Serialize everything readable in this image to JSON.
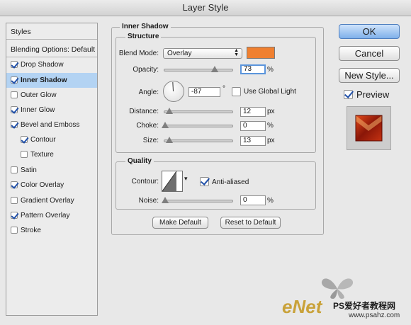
{
  "window": {
    "title": "Layer Style"
  },
  "sidebar": {
    "header": "Styles",
    "blending": "Blending Options: Default",
    "items": [
      {
        "label": "Drop Shadow",
        "checked": true
      },
      {
        "label": "Inner Shadow",
        "checked": true,
        "selected": true
      },
      {
        "label": "Outer Glow",
        "checked": false
      },
      {
        "label": "Inner Glow",
        "checked": true
      },
      {
        "label": "Bevel and Emboss",
        "checked": true
      },
      {
        "label": "Contour",
        "checked": true
      },
      {
        "label": "Texture",
        "checked": false
      },
      {
        "label": "Satin",
        "checked": false
      },
      {
        "label": "Color Overlay",
        "checked": true
      },
      {
        "label": "Gradient Overlay",
        "checked": false
      },
      {
        "label": "Pattern Overlay",
        "checked": true
      },
      {
        "label": "Stroke",
        "checked": false
      }
    ]
  },
  "panel": {
    "title": "Inner Shadow",
    "structure": {
      "title": "Structure",
      "blend_mode_label": "Blend Mode:",
      "blend_mode_value": "Overlay",
      "blend_color": "#f08030",
      "opacity_label": "Opacity:",
      "opacity_value": "73",
      "opacity_level": 0.73,
      "opacity_unit": "%",
      "angle_label": "Angle:",
      "angle_value": "-87",
      "angle_unit": "°",
      "global_light_label": "Use Global Light",
      "global_light_checked": false,
      "distance_label": "Distance:",
      "distance_value": "12",
      "distance_unit": "px",
      "choke_label": "Choke:",
      "choke_value": "0",
      "choke_unit": "%",
      "size_label": "Size:",
      "size_value": "13",
      "size_unit": "px"
    },
    "quality": {
      "title": "Quality",
      "contour_label": "Contour:",
      "anti_aliased_label": "Anti-aliased",
      "anti_aliased_checked": true,
      "noise_label": "Noise:",
      "noise_value": "0",
      "noise_unit": "%"
    },
    "make_default": "Make Default",
    "reset_default": "Reset to Default"
  },
  "actions": {
    "ok": "OK",
    "cancel": "Cancel",
    "new_style": "New Style...",
    "preview_label": "Preview",
    "preview_checked": true
  },
  "watermark": {
    "logo": "eNet",
    "site_cn": "PS爱好者教程网",
    "url": "www.psahz.com"
  }
}
